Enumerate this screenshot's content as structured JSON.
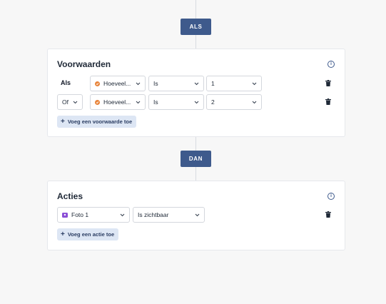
{
  "als_pill": "ALS",
  "dan_pill": "DAN",
  "conditions": {
    "title": "Voorwaarden",
    "info_icon": "i",
    "rows": [
      {
        "label": "Als",
        "field": "Hoeveel...",
        "operator": "Is",
        "value": "1"
      },
      {
        "connector": "Of",
        "field": "Hoeveel...",
        "operator": "Is",
        "value": "2"
      }
    ],
    "add_label": "Voeg een voorwaarde toe"
  },
  "actions": {
    "title": "Acties",
    "info_icon": "i",
    "rows": [
      {
        "target": "Foto 1",
        "action": "Is zichtbaar"
      }
    ],
    "add_label": "Voeg een actie toe"
  },
  "colors": {
    "primary": "#3e5a8c",
    "field_dot": "#e8843a",
    "photo_icon": "#8b4fd6",
    "add_button_bg": "#dde6f4"
  },
  "icons": {
    "field": "orange-circle-icon",
    "photo": "camera-icon",
    "delete": "trash-icon",
    "dropdown": "chevron-down-icon",
    "info": "info-icon",
    "add": "plus-icon"
  }
}
